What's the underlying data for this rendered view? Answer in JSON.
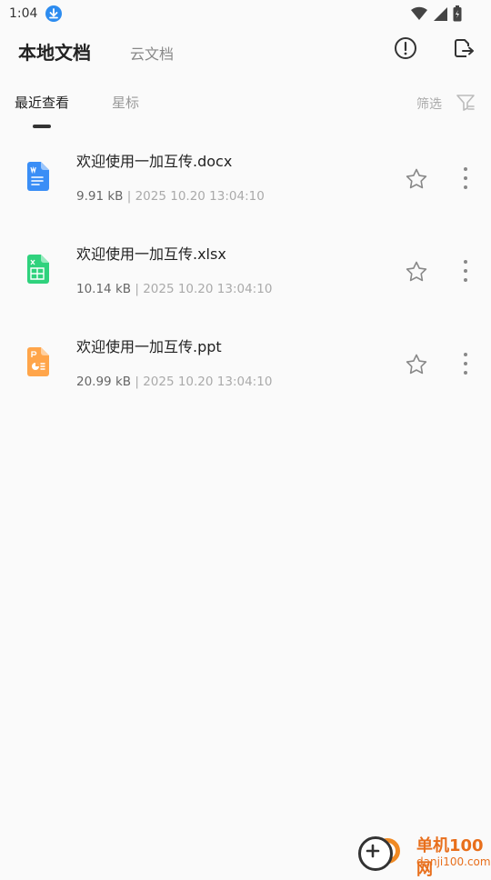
{
  "status_bar": {
    "time": "1:04"
  },
  "header": {
    "title": "本地文档",
    "cloud_tab": "云文档"
  },
  "subtabs": {
    "recent": "最近查看",
    "starred": "星标",
    "filter": "筛选"
  },
  "files": [
    {
      "name": "欢迎使用一加互传.docx",
      "size": "9.91 kB",
      "separator": "|",
      "date": "2025 10.20 13:04:10",
      "type": "doc",
      "color": "#3a8ef6"
    },
    {
      "name": "欢迎使用一加互传.xlsx",
      "size": "10.14 kB",
      "separator": "|",
      "date": "2025 10.20 13:04:10",
      "type": "xls",
      "color": "#2fd27d"
    },
    {
      "name": "欢迎使用一加互传.ppt",
      "size": "20.99 kB",
      "separator": "|",
      "date": "2025 10.20 13:04:10",
      "type": "ppt",
      "color": "#ffa54a"
    }
  ],
  "watermark": {
    "name": "单机100网",
    "url": "danji100.com"
  }
}
